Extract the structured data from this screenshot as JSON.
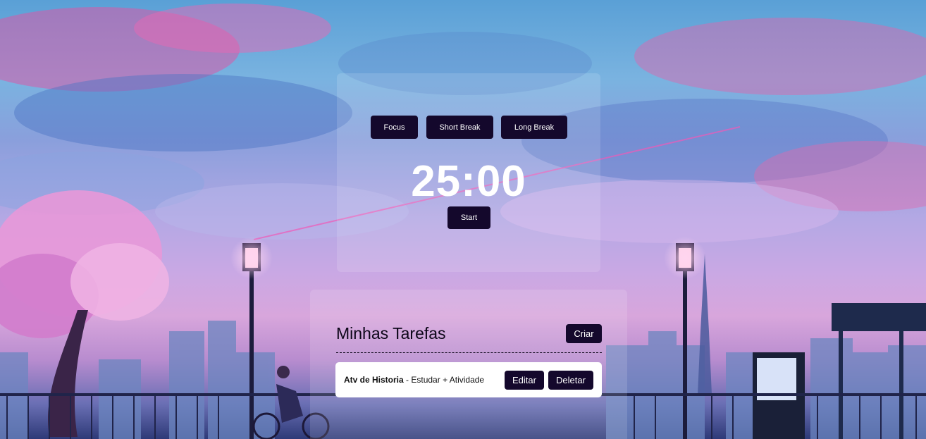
{
  "timer": {
    "modes": [
      {
        "label": "Focus"
      },
      {
        "label": "Short Break"
      },
      {
        "label": "Long Break"
      }
    ],
    "display": "25:00",
    "start_label": "Start"
  },
  "tasks": {
    "title": "Minhas Tarefas",
    "create_label": "Criar",
    "items": [
      {
        "title": "Atv de Historia",
        "description": "Estudar + Atividade",
        "edit_label": "Editar",
        "delete_label": "Deletar"
      }
    ]
  },
  "colors": {
    "button_bg": "#14082c",
    "button_text": "#ffffff",
    "panel_bg": "rgba(255,255,255,0.13)"
  }
}
